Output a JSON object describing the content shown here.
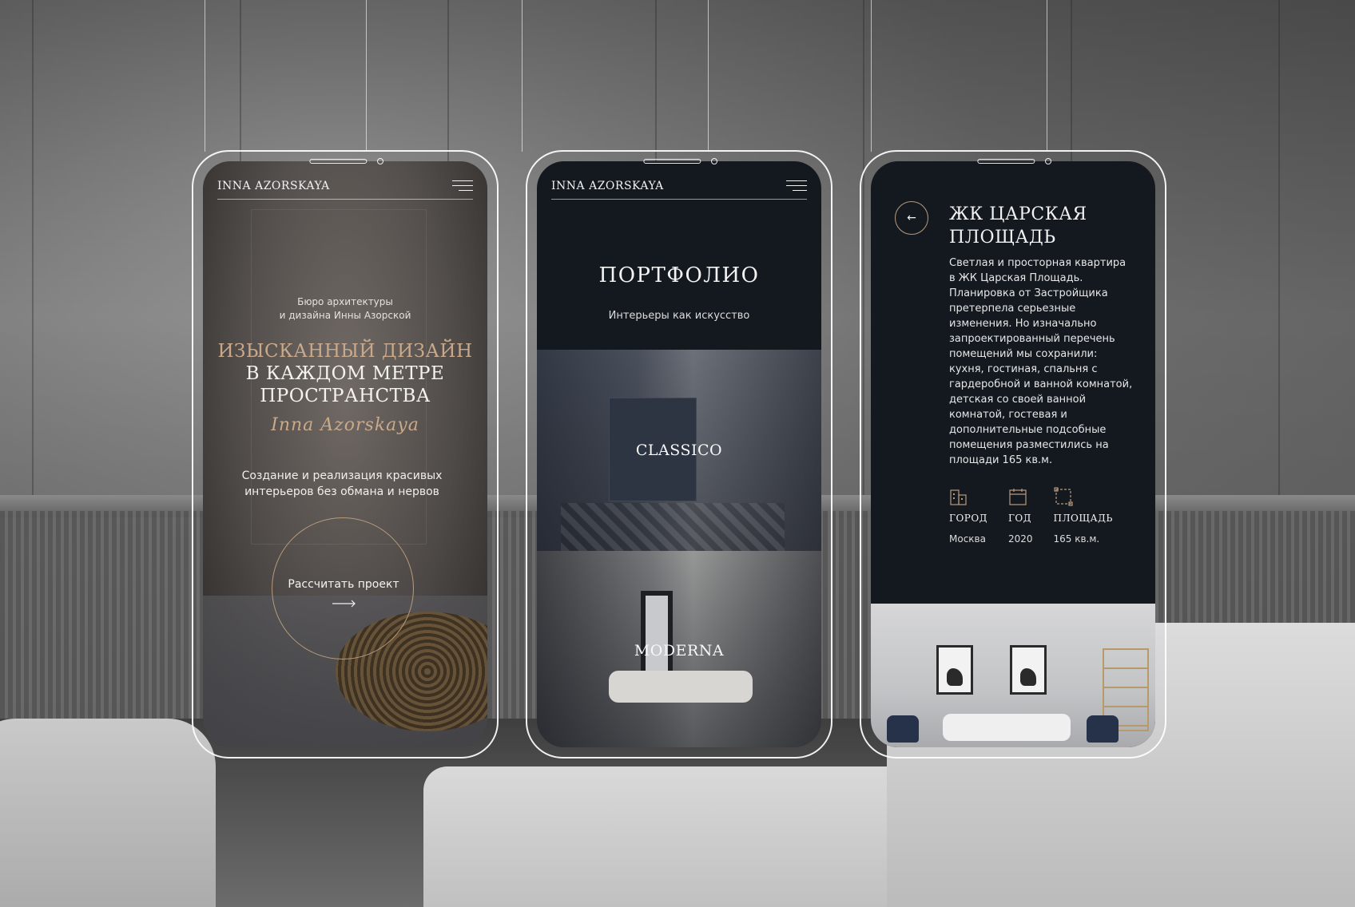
{
  "brand": {
    "name": "INNA AZORSKAYA"
  },
  "screen_home": {
    "subtitle_line1": "Бюро архитектуры",
    "subtitle_line2": "и дизайна Инны Азорской",
    "title_line1": "ИЗЫСКАННЫЙ ДИЗАЙН",
    "title_line2": "В КАЖДОМ МЕТРЕ",
    "title_line3": "ПРОСТРАНСТВА",
    "signature": "Inna Azorskaya",
    "description": "Создание и реализация красивых интерьеров без обмана и нервов",
    "cta_label": "Рассчитать проект"
  },
  "screen_portfolio": {
    "title": "ПОРТФОЛИО",
    "subtitle": "Интерьеры как искусство",
    "cards": [
      {
        "label": "CLASSICO"
      },
      {
        "label": "MODERNA"
      }
    ]
  },
  "screen_project": {
    "title_line1": "ЖК ЦАРСКАЯ",
    "title_line2": "ПЛОЩАДЬ",
    "description": "Светлая и просторная квартира в ЖК Царская Площадь. Планировка от Застройщика претерпела серьезные изменения. Но изначально запроектированный перечень помещений мы сохранили: кухня, гостиная, спальня с гардеробной и ванной комнатой, детская со своей ванной комнатой, гостевая и дополнительные подсобные помещения разместились на площади 165 кв.м.",
    "stats": [
      {
        "icon": "city-icon",
        "label": "ГОРОД",
        "value": "Москва"
      },
      {
        "icon": "calendar-icon",
        "label": "ГОД",
        "value": "2020"
      },
      {
        "icon": "area-icon",
        "label": "ПЛОЩАДЬ",
        "value": "165 кв.м."
      }
    ]
  },
  "colors": {
    "accent_gold": "#c9a98a",
    "dark_bg": "#141920",
    "frame_white": "#ffffff"
  }
}
